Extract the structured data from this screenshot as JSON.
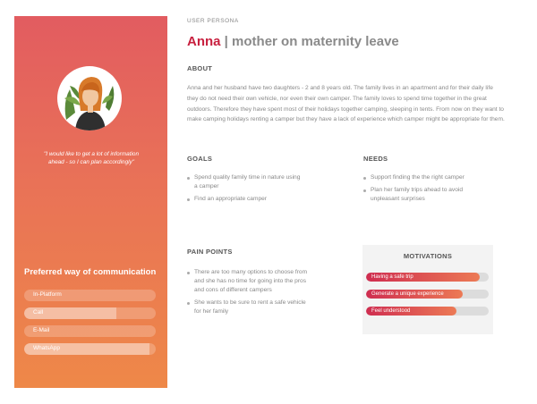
{
  "header": {
    "overline": "USER PERSONA",
    "name": "Anna",
    "separator": " | ",
    "role": "mother on maternity leave"
  },
  "sidebar": {
    "avatar_icon": "persona-portrait",
    "quote": "\"I would like to get a lot of information ahead - so I can plan accordingly\"",
    "comm_title": "Preferred way of communication",
    "channels": [
      {
        "label": "In-Platform",
        "level": 0.0
      },
      {
        "label": "Call",
        "level": 0.7
      },
      {
        "label": "E-Mail",
        "level": 0.0
      },
      {
        "label": "WhatsApp",
        "level": 0.95
      }
    ]
  },
  "about": {
    "heading": "ABOUT",
    "text": "Anna and her husband have two daughters - 2 and 8 years old. The family lives in an apartment and for their daily life they do not need their own vehicle, nor even their own camper. The family loves to spend time together in the great outdoors. Therefore they have spent most of their holidays together camping, sleeping in tents. From now on they want to make camping holidays renting a camper but they have a lack of experience which camper might be appropriate for them."
  },
  "goals": {
    "heading": "GOALS",
    "items": [
      "Spend quality family time in nature using a camper",
      "Find an appropriate camper"
    ]
  },
  "needs": {
    "heading": "NEEDS",
    "items": [
      "Support finding the the right camper",
      "Plan  her family trips ahead to avoid unpleasant surprises"
    ]
  },
  "pain_points": {
    "heading": "PAIN POINTS",
    "items": [
      "There are too many options to choose from and she has no time for going into the pros and cons of different campers",
      "She wants to be sure to rent a safe vehicle for her family"
    ]
  },
  "motivations": {
    "heading": "MOTIVATIONS",
    "items": [
      {
        "label": "Having a safe trip",
        "level": 0.93
      },
      {
        "label": "Generate a unique experience",
        "level": 0.79
      },
      {
        "label": "Feel understood",
        "level": 0.74
      }
    ]
  },
  "colors": {
    "accent": "#c8203f",
    "gradient_top": "#e25c60",
    "gradient_bottom": "#ee8848"
  }
}
